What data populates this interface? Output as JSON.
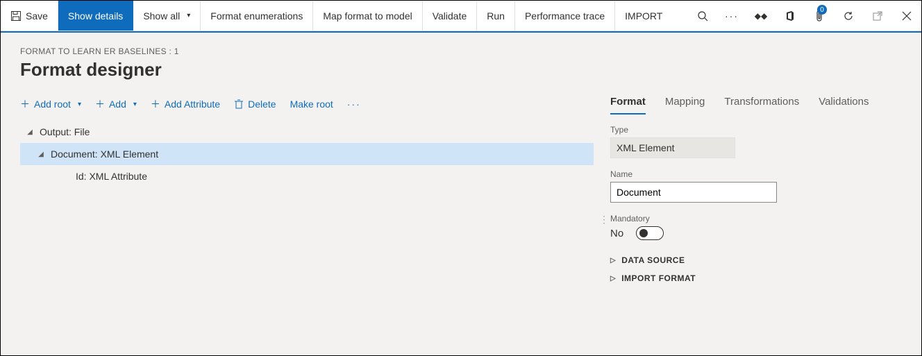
{
  "toolbar": {
    "save": "Save",
    "show_details": "Show details",
    "show_all": "Show all",
    "format_enum": "Format enumerations",
    "map_format": "Map format to model",
    "validate": "Validate",
    "run": "Run",
    "perf_trace": "Performance trace",
    "import": "IMPORT",
    "badge_count": "0"
  },
  "breadcrumb": "FORMAT TO LEARN ER BASELINES : 1",
  "page_title": "Format designer",
  "actions": {
    "add_root": "Add root",
    "add": "Add",
    "add_attribute": "Add Attribute",
    "delete": "Delete",
    "make_root": "Make root"
  },
  "tree": {
    "node0": "Output: File",
    "node1": "Document: XML Element",
    "node2": "Id: XML Attribute"
  },
  "tabs": {
    "format": "Format",
    "mapping": "Mapping",
    "transformations": "Transformations",
    "validations": "Validations"
  },
  "panel": {
    "type_label": "Type",
    "type_value": "XML Element",
    "name_label": "Name",
    "name_value": "Document",
    "mandatory_label": "Mandatory",
    "mandatory_value": "No",
    "data_source": "DATA SOURCE",
    "import_format": "IMPORT FORMAT"
  }
}
